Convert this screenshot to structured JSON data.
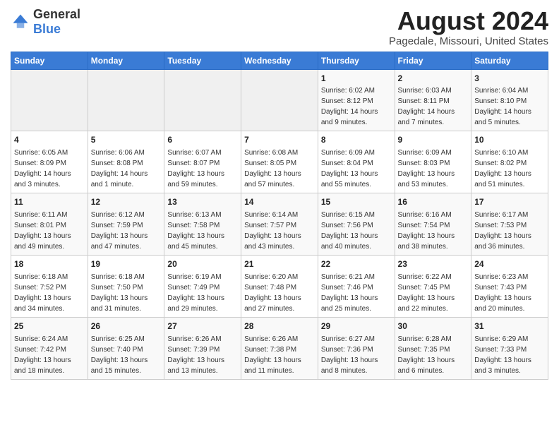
{
  "logo": {
    "general": "General",
    "blue": "Blue"
  },
  "title": "August 2024",
  "subtitle": "Pagedale, Missouri, United States",
  "weekdays": [
    "Sunday",
    "Monday",
    "Tuesday",
    "Wednesday",
    "Thursday",
    "Friday",
    "Saturday"
  ],
  "weeks": [
    [
      {
        "day": "",
        "info": ""
      },
      {
        "day": "",
        "info": ""
      },
      {
        "day": "",
        "info": ""
      },
      {
        "day": "",
        "info": ""
      },
      {
        "day": "1",
        "info": "Sunrise: 6:02 AM\nSunset: 8:12 PM\nDaylight: 14 hours\nand 9 minutes."
      },
      {
        "day": "2",
        "info": "Sunrise: 6:03 AM\nSunset: 8:11 PM\nDaylight: 14 hours\nand 7 minutes."
      },
      {
        "day": "3",
        "info": "Sunrise: 6:04 AM\nSunset: 8:10 PM\nDaylight: 14 hours\nand 5 minutes."
      }
    ],
    [
      {
        "day": "4",
        "info": "Sunrise: 6:05 AM\nSunset: 8:09 PM\nDaylight: 14 hours\nand 3 minutes."
      },
      {
        "day": "5",
        "info": "Sunrise: 6:06 AM\nSunset: 8:08 PM\nDaylight: 14 hours\nand 1 minute."
      },
      {
        "day": "6",
        "info": "Sunrise: 6:07 AM\nSunset: 8:07 PM\nDaylight: 13 hours\nand 59 minutes."
      },
      {
        "day": "7",
        "info": "Sunrise: 6:08 AM\nSunset: 8:05 PM\nDaylight: 13 hours\nand 57 minutes."
      },
      {
        "day": "8",
        "info": "Sunrise: 6:09 AM\nSunset: 8:04 PM\nDaylight: 13 hours\nand 55 minutes."
      },
      {
        "day": "9",
        "info": "Sunrise: 6:09 AM\nSunset: 8:03 PM\nDaylight: 13 hours\nand 53 minutes."
      },
      {
        "day": "10",
        "info": "Sunrise: 6:10 AM\nSunset: 8:02 PM\nDaylight: 13 hours\nand 51 minutes."
      }
    ],
    [
      {
        "day": "11",
        "info": "Sunrise: 6:11 AM\nSunset: 8:01 PM\nDaylight: 13 hours\nand 49 minutes."
      },
      {
        "day": "12",
        "info": "Sunrise: 6:12 AM\nSunset: 7:59 PM\nDaylight: 13 hours\nand 47 minutes."
      },
      {
        "day": "13",
        "info": "Sunrise: 6:13 AM\nSunset: 7:58 PM\nDaylight: 13 hours\nand 45 minutes."
      },
      {
        "day": "14",
        "info": "Sunrise: 6:14 AM\nSunset: 7:57 PM\nDaylight: 13 hours\nand 43 minutes."
      },
      {
        "day": "15",
        "info": "Sunrise: 6:15 AM\nSunset: 7:56 PM\nDaylight: 13 hours\nand 40 minutes."
      },
      {
        "day": "16",
        "info": "Sunrise: 6:16 AM\nSunset: 7:54 PM\nDaylight: 13 hours\nand 38 minutes."
      },
      {
        "day": "17",
        "info": "Sunrise: 6:17 AM\nSunset: 7:53 PM\nDaylight: 13 hours\nand 36 minutes."
      }
    ],
    [
      {
        "day": "18",
        "info": "Sunrise: 6:18 AM\nSunset: 7:52 PM\nDaylight: 13 hours\nand 34 minutes."
      },
      {
        "day": "19",
        "info": "Sunrise: 6:18 AM\nSunset: 7:50 PM\nDaylight: 13 hours\nand 31 minutes."
      },
      {
        "day": "20",
        "info": "Sunrise: 6:19 AM\nSunset: 7:49 PM\nDaylight: 13 hours\nand 29 minutes."
      },
      {
        "day": "21",
        "info": "Sunrise: 6:20 AM\nSunset: 7:48 PM\nDaylight: 13 hours\nand 27 minutes."
      },
      {
        "day": "22",
        "info": "Sunrise: 6:21 AM\nSunset: 7:46 PM\nDaylight: 13 hours\nand 25 minutes."
      },
      {
        "day": "23",
        "info": "Sunrise: 6:22 AM\nSunset: 7:45 PM\nDaylight: 13 hours\nand 22 minutes."
      },
      {
        "day": "24",
        "info": "Sunrise: 6:23 AM\nSunset: 7:43 PM\nDaylight: 13 hours\nand 20 minutes."
      }
    ],
    [
      {
        "day": "25",
        "info": "Sunrise: 6:24 AM\nSunset: 7:42 PM\nDaylight: 13 hours\nand 18 minutes."
      },
      {
        "day": "26",
        "info": "Sunrise: 6:25 AM\nSunset: 7:40 PM\nDaylight: 13 hours\nand 15 minutes."
      },
      {
        "day": "27",
        "info": "Sunrise: 6:26 AM\nSunset: 7:39 PM\nDaylight: 13 hours\nand 13 minutes."
      },
      {
        "day": "28",
        "info": "Sunrise: 6:26 AM\nSunset: 7:38 PM\nDaylight: 13 hours\nand 11 minutes."
      },
      {
        "day": "29",
        "info": "Sunrise: 6:27 AM\nSunset: 7:36 PM\nDaylight: 13 hours\nand 8 minutes."
      },
      {
        "day": "30",
        "info": "Sunrise: 6:28 AM\nSunset: 7:35 PM\nDaylight: 13 hours\nand 6 minutes."
      },
      {
        "day": "31",
        "info": "Sunrise: 6:29 AM\nSunset: 7:33 PM\nDaylight: 13 hours\nand 3 minutes."
      }
    ]
  ]
}
